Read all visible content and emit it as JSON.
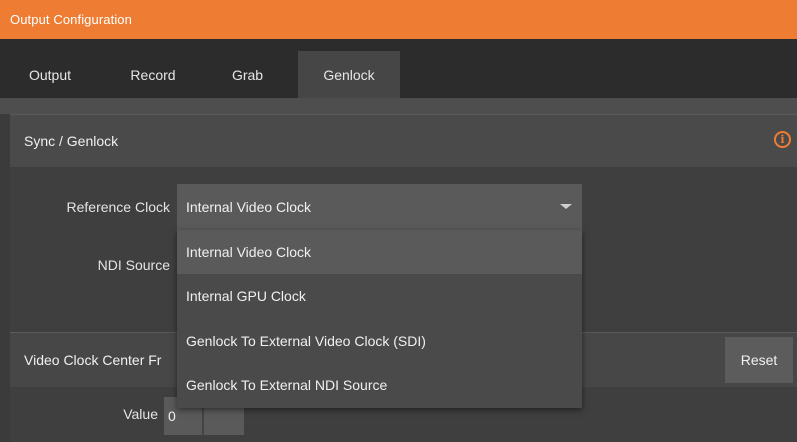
{
  "window": {
    "title": "Output Configuration"
  },
  "tabs": [
    {
      "label": "Output",
      "active": false
    },
    {
      "label": "Record",
      "active": false
    },
    {
      "label": "Grab",
      "active": false
    },
    {
      "label": "Genlock",
      "active": true
    }
  ],
  "sync_section": {
    "title": "Sync / Genlock",
    "info_icon": "info-icon",
    "reference_clock_label": "Reference Clock",
    "reference_clock_value": "Internal Video Clock",
    "ndi_source_label": "NDI Source",
    "options": [
      "Internal Video Clock",
      "Internal GPU Clock",
      "Genlock To External Video Clock (SDI)",
      "Genlock To External NDI Source"
    ]
  },
  "video_clock_section": {
    "title": "Video Clock Center Fr",
    "reset_label": "Reset",
    "value_label": "Value",
    "value": "0"
  },
  "colors": {
    "accent": "#ee7d33",
    "background": "#3b3b3b"
  }
}
